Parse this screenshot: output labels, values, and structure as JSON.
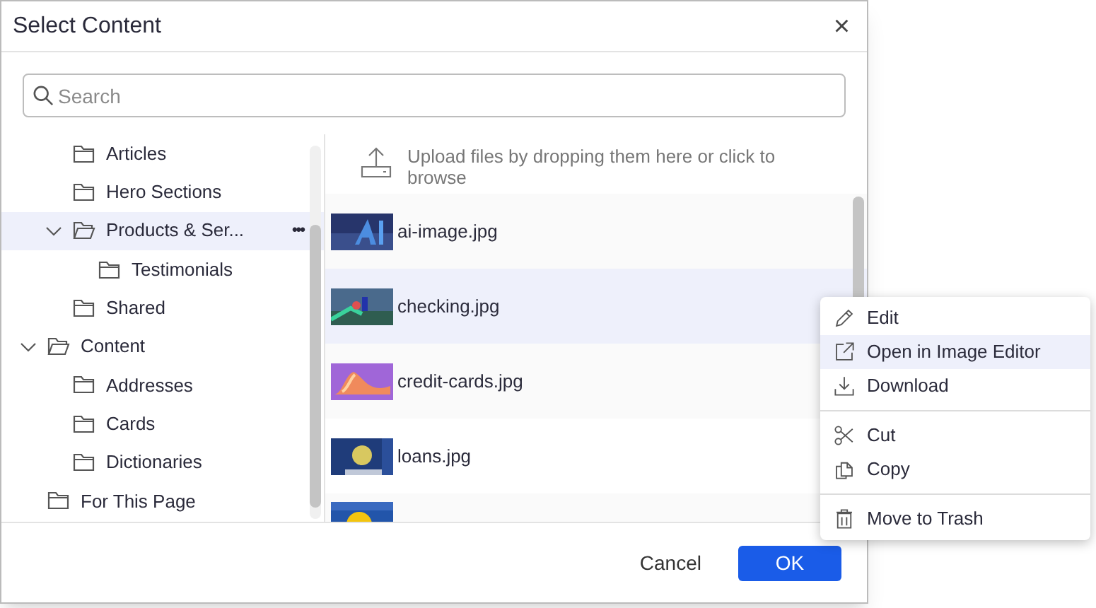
{
  "dialog": {
    "title": "Select Content",
    "close": "×",
    "search": {
      "placeholder": "Search"
    },
    "tree": [
      {
        "children": [
          {
            "label": "Articles",
            "selected": false
          },
          {
            "label": "Hero Sections",
            "selected": false
          },
          {
            "label": "Products & Ser...",
            "selected": true,
            "expanded": true,
            "more": "•••",
            "children": [
              {
                "label": "Testimonials",
                "selected": false
              }
            ]
          },
          {
            "label": "Shared",
            "selected": false
          }
        ]
      },
      {
        "label": "Content",
        "selected": false,
        "expanded": true,
        "children": [
          {
            "label": "Addresses",
            "selected": false
          },
          {
            "label": "Cards",
            "selected": false
          },
          {
            "label": "Dictionaries",
            "selected": false
          }
        ]
      },
      {
        "label": "For This Page",
        "selected": false
      }
    ],
    "upload": "Upload files by dropping them here or click to browse",
    "files": [
      {
        "kind": "file",
        "name": "ai-image.jpg",
        "selected": false
      },
      {
        "kind": "file",
        "name": "checking.jpg",
        "selected": true
      },
      {
        "kind": "file",
        "name": "credit-cards.jpg",
        "selected": false
      },
      {
        "kind": "file",
        "name": "loans.jpg",
        "selected": false
      },
      {
        "kind": "picture",
        "selected": false
      }
    ],
    "buttons": [
      {
        "label": "Cancel",
        "kind": "secondary"
      },
      {
        "label": "OK",
        "kind": "primary"
      }
    ]
  },
  "context_menu": [
    {
      "kind": "item",
      "label": "Edit",
      "selected": false
    },
    {
      "kind": "item",
      "label": "Open in Image Editor",
      "selected": true
    },
    {
      "kind": "item",
      "label": "Download",
      "selected": false
    },
    {
      "kind": "divider"
    },
    {
      "kind": "item",
      "label": "Cut",
      "selected": false
    },
    {
      "kind": "item",
      "label": "Copy",
      "selected": false
    },
    {
      "kind": "divider"
    },
    {
      "kind": "item",
      "label": "Move to Trash",
      "selected": false
    }
  ]
}
